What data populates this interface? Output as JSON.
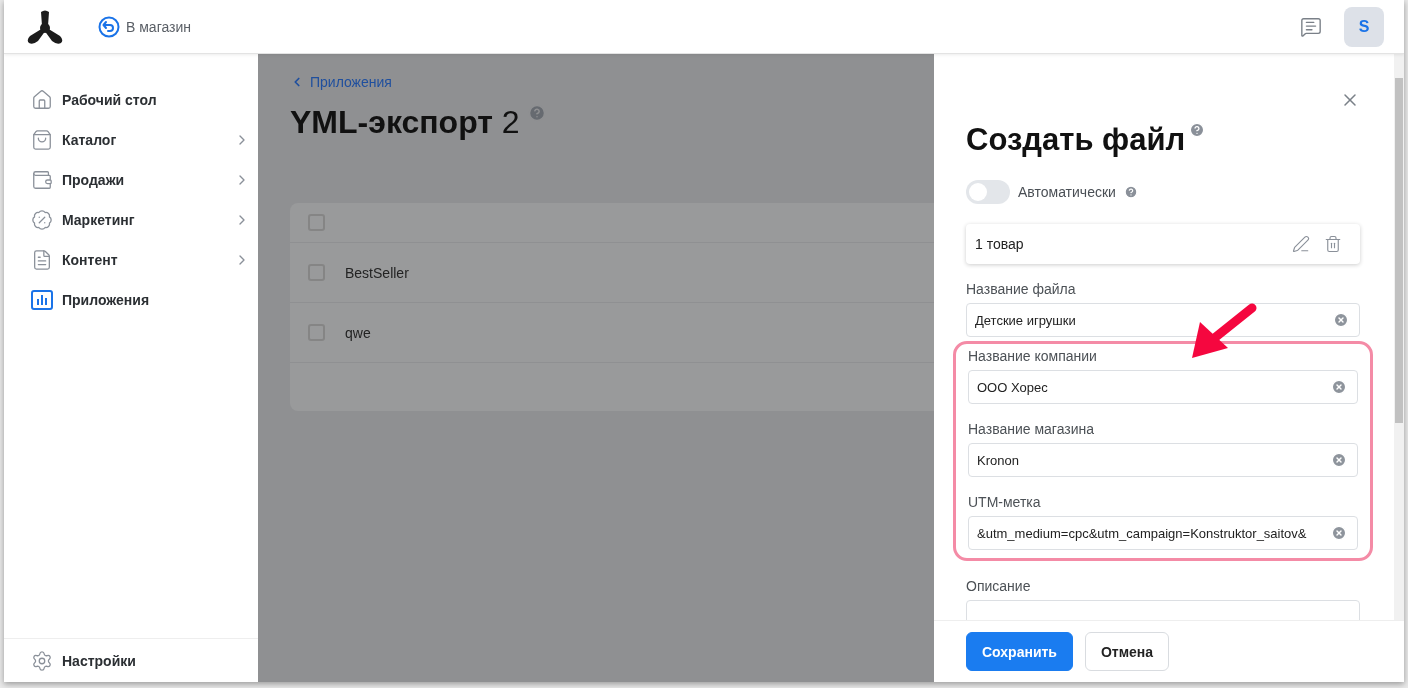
{
  "header": {
    "back_link": "В магазин",
    "avatar": "S"
  },
  "sidebar": {
    "items": [
      {
        "label": "Рабочий стол",
        "expandable": false,
        "selected": false
      },
      {
        "label": "Каталог",
        "expandable": true,
        "selected": false
      },
      {
        "label": "Продажи",
        "expandable": true,
        "selected": false
      },
      {
        "label": "Маркетинг",
        "expandable": true,
        "selected": false
      },
      {
        "label": "Контент",
        "expandable": true,
        "selected": false
      },
      {
        "label": "Приложения",
        "expandable": false,
        "selected": true
      }
    ],
    "footer_item": {
      "label": "Настройки"
    }
  },
  "main": {
    "breadcrumb": "Приложения",
    "title": "YML-экспорт",
    "count": "2",
    "table": {
      "header_checked": false,
      "rows": [
        {
          "name": "BestSeller",
          "checked": false
        },
        {
          "name": "qwe",
          "checked": false
        }
      ]
    }
  },
  "drawer": {
    "title": "Создать файл",
    "auto_toggle": {
      "label": "Автоматически",
      "on": false
    },
    "product_card": {
      "text": "1 товар"
    },
    "fields": [
      {
        "label": "Название файла",
        "value": "Детские игрушки",
        "highlighted": false
      },
      {
        "label": "Название компании",
        "value": "ООО Хорес",
        "highlighted": true
      },
      {
        "label": "Название магазина",
        "value": "Kronon",
        "highlighted": true
      },
      {
        "label": "UTM-метка",
        "value": "&utm_medium=cpc&utm_campaign=Konstruktor_saitov&",
        "highlighted": true
      },
      {
        "label": "Описание",
        "highlighted": false
      }
    ],
    "buttons": [
      {
        "label": "Сохранить",
        "kind": "primary"
      },
      {
        "label": "Отмена",
        "kind": "secondary"
      }
    ]
  },
  "annotations": {
    "arrow": true
  }
}
